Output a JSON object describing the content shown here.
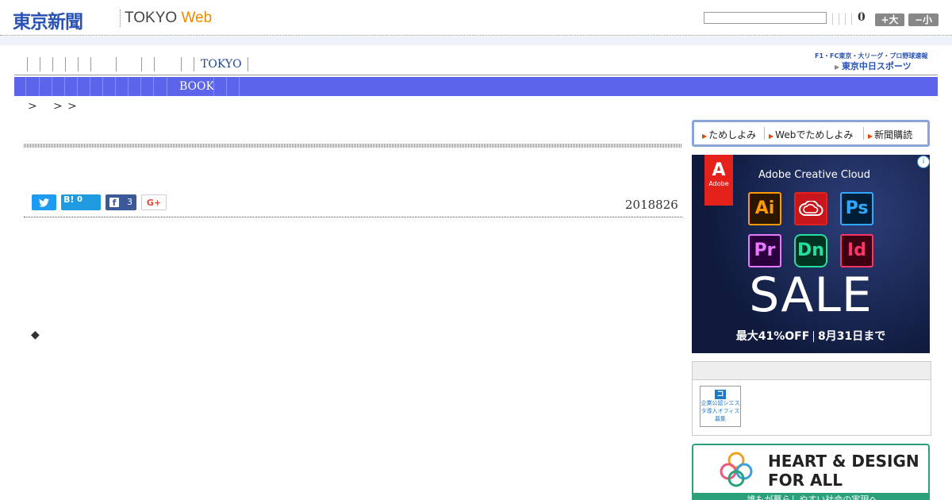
{
  "header": {
    "logo_jp": "東京新聞",
    "logo_en": "TOKYO",
    "logo_web": "Web",
    "search": {
      "value": "",
      "count": "0"
    },
    "font_larger": "+大",
    "font_smaller": "−小"
  },
  "nav1": {
    "tokyo_label": "TOKYO"
  },
  "sports_link": {
    "line1": "F1・FC東京・大リーグ・プロ野球速報",
    "line2": "東京中日スポーツ"
  },
  "nav2": {
    "book_label": "BOOK"
  },
  "breadcrumb": [
    ">",
    ">",
    ">"
  ],
  "article": {
    "date": "2018826",
    "share": {
      "twitter_icon": "twitter-bird-icon",
      "hatena": "B!",
      "hatena_count": "0",
      "facebook_count": "3",
      "gplus": "G+"
    },
    "bullet": "◆"
  },
  "sidebar": {
    "subnav": [
      "ためしよみ",
      "Webでためしよみ",
      "新聞購読"
    ],
    "ad": {
      "info": "i",
      "brand": "Adobe",
      "title": "Adobe Creative Cloud",
      "apps": [
        {
          "label": "Ai",
          "color": "#ff9a00"
        },
        {
          "label": "cc-icon",
          "color": "#e4211b"
        },
        {
          "label": "Ps",
          "color": "#31a8ff"
        },
        {
          "label": "Pr",
          "color": "#ea77ff"
        },
        {
          "label": "Dn",
          "color": "#22e0a0"
        },
        {
          "label": "Id",
          "color": "#ff3366"
        }
      ],
      "sale": "SALE",
      "offer": "最大41%OFF",
      "deadline": "8月31日まで"
    },
    "badge": {
      "icon": "コ",
      "text": "企業公認シエスタ導入オフィス募集"
    },
    "heart": {
      "title": "HEART & DESIGN\nFOR ALL",
      "band": "誰もが暮らしやすい社会の実現へ"
    }
  }
}
